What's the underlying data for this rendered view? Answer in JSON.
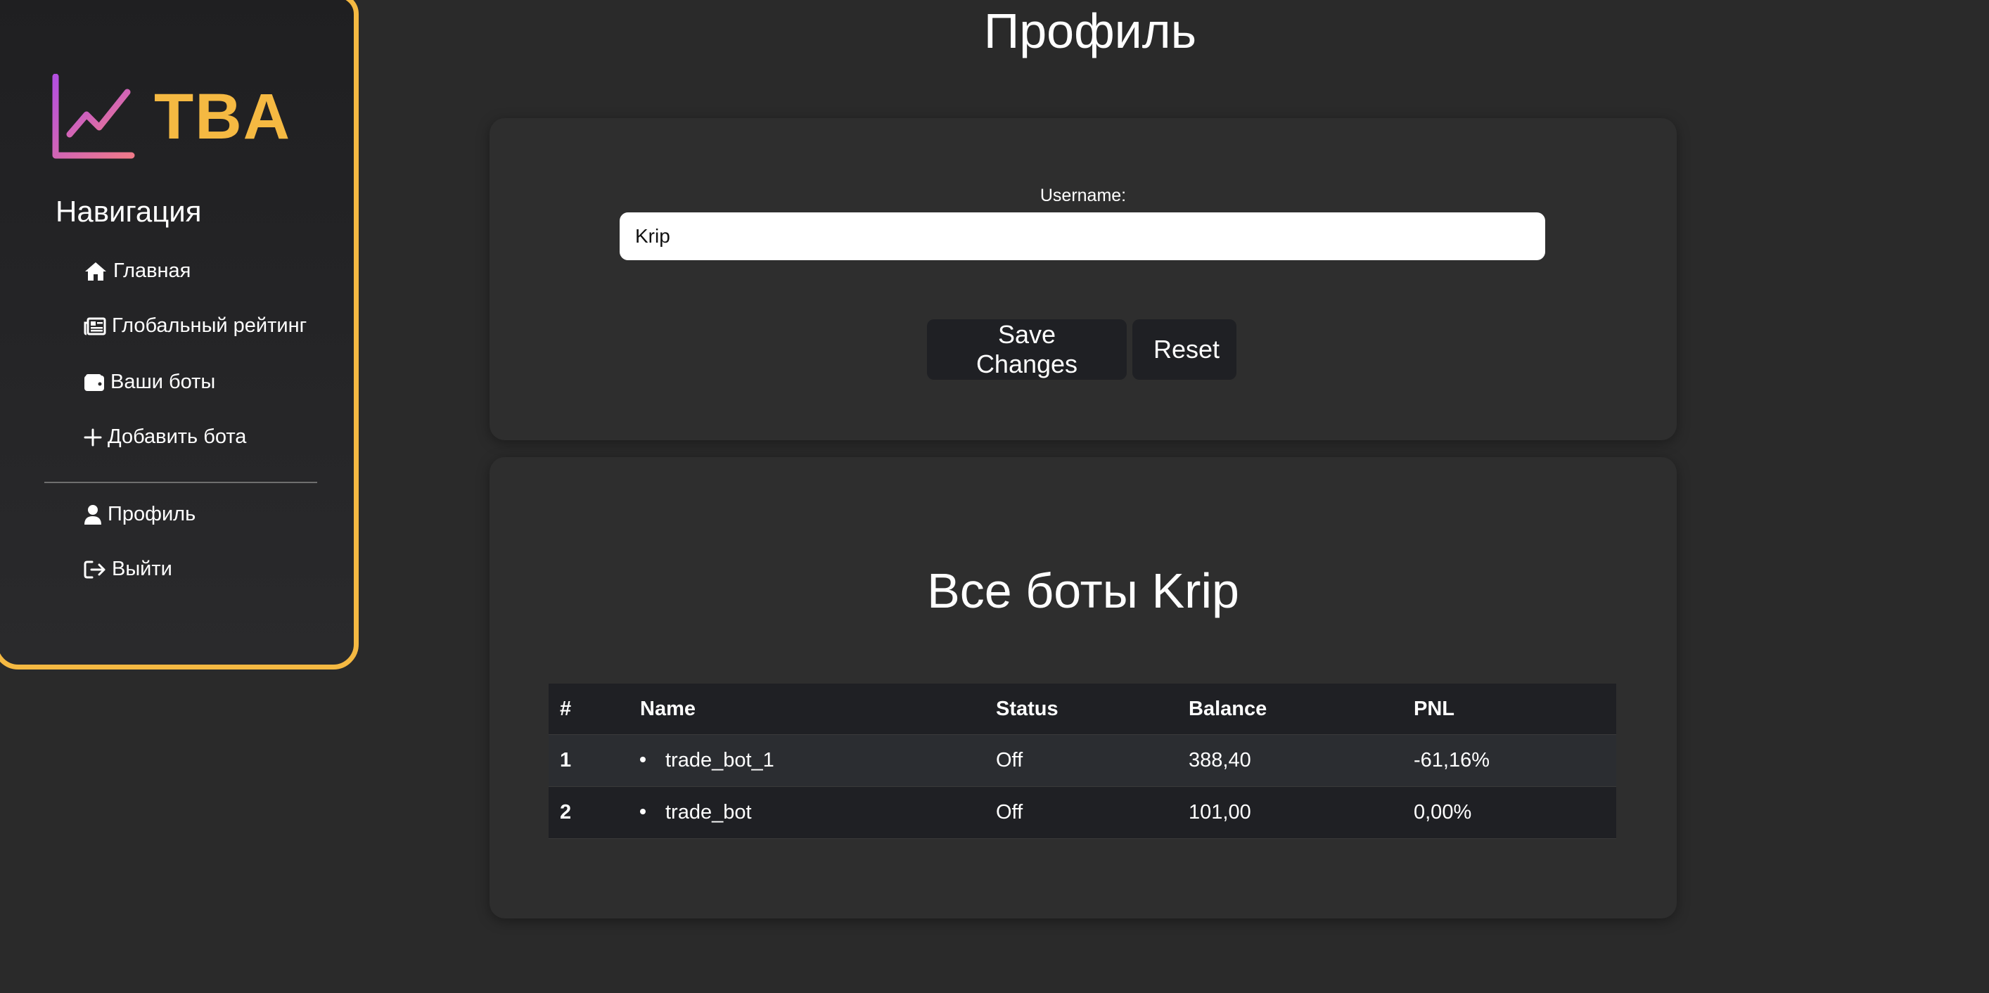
{
  "app": {
    "logo_text": "TBA",
    "accent_color": "#f5b942",
    "logo_gradient": [
      "#c24bd6",
      "#f07a8a"
    ]
  },
  "sidebar": {
    "title": "Навигация",
    "items": [
      {
        "label": "Главная",
        "icon": "home-icon"
      },
      {
        "label": "Глобальный рейтинг",
        "icon": "newspaper-icon"
      },
      {
        "label": "Ваши боты",
        "icon": "wallet-icon"
      },
      {
        "label": "Добавить бота",
        "icon": "plus-icon"
      },
      {
        "label": "Профиль",
        "icon": "user-icon"
      },
      {
        "label": "Выйти",
        "icon": "logout-icon"
      }
    ]
  },
  "page": {
    "title": "Профиль"
  },
  "profile_form": {
    "username_label": "Username:",
    "username_value": "Krip",
    "save_label": "Save Changes",
    "reset_label": "Reset"
  },
  "bots_section": {
    "title": "Все боты Krip",
    "columns": [
      "#",
      "Name",
      "Status",
      "Balance",
      "PNL"
    ],
    "rows": [
      {
        "num": "1",
        "name": "trade_bot_1",
        "status": "Off",
        "balance": "388,40",
        "pnl": "-61,16%"
      },
      {
        "num": "2",
        "name": "trade_bot",
        "status": "Off",
        "balance": "101,00",
        "pnl": "0,00%"
      }
    ]
  }
}
